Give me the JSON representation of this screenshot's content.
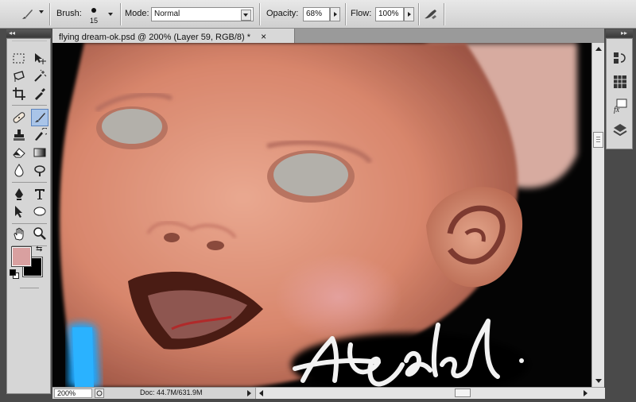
{
  "options_bar": {
    "brush_label": "Brush:",
    "brush_size": "15",
    "mode_label": "Mode:",
    "mode_value": "Normal",
    "opacity_label": "Opacity:",
    "opacity_value": "68%",
    "flow_label": "Flow:",
    "flow_value": "100%"
  },
  "document": {
    "tab_title": "flying dream-ok.psd @ 200% (Layer 59, RGB/8) *",
    "close_glyph": "×"
  },
  "status_bar": {
    "zoom": "200%",
    "doc_info": "Doc: 44.7M/631.9M"
  },
  "colors": {
    "foreground": "#d9a0a0",
    "background": "#000000",
    "selection_highlight": "#a9c4e8"
  },
  "tools": [
    "rectangular-marquee",
    "move",
    "lasso",
    "magic-wand",
    "crop",
    "eyedropper",
    "spot-healing-brush",
    "brush",
    "clone-stamp",
    "history-brush",
    "eraser",
    "gradient",
    "blur",
    "dodge",
    "pen",
    "type",
    "path-selection",
    "ellipse",
    "hand",
    "zoom"
  ],
  "dock_icons": [
    "history-icon",
    "swatches-icon",
    "styles-icon",
    "layers-icon"
  ]
}
